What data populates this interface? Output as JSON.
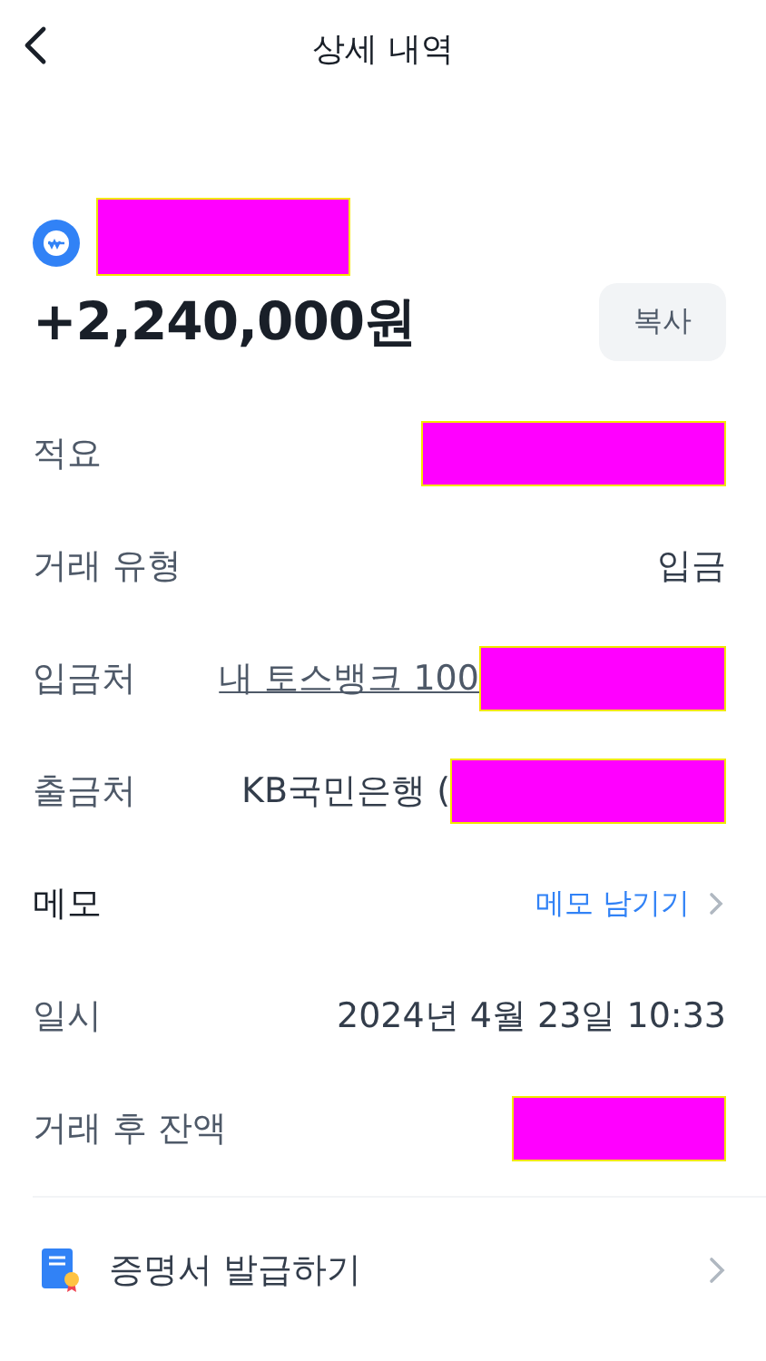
{
  "header": {
    "title": "상세 내역"
  },
  "summary": {
    "name_redacted": true,
    "amount": "+2,240,000원",
    "copy_button": "복사"
  },
  "rows": [
    {
      "label": "적요",
      "redacted": true
    },
    {
      "label": "거래 유형",
      "kind": "text",
      "value": "입금",
      "redacted": false
    },
    {
      "label": "입금처",
      "kind": "link",
      "value": "내 토스뱅크 100",
      "redacted": true
    },
    {
      "label": "출금처",
      "kind": "text",
      "value": "KB국민은행 (",
      "redacted": true
    },
    {
      "label": "메모",
      "kind": "action",
      "value": "메모 남기기",
      "redacted": false
    },
    {
      "label": "일시",
      "kind": "text",
      "value": "2024년 4월 23일 10:33",
      "redacted": false
    },
    {
      "label": "거래 후 잔액",
      "redacted": true
    }
  ],
  "certificate": {
    "label": "증명서 발급하기"
  }
}
